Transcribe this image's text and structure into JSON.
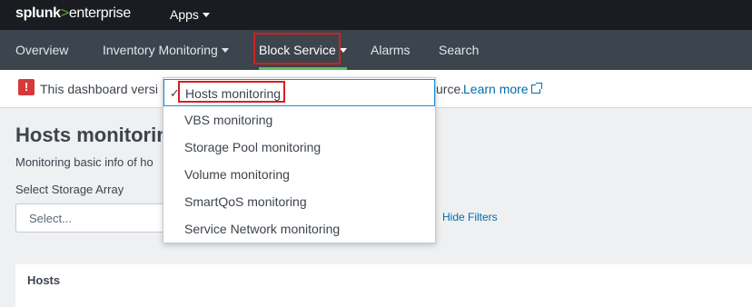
{
  "topbar": {
    "logo_main": "splunk",
    "logo_sep": ">",
    "logo_sub": "enterprise",
    "apps_label": "Apps"
  },
  "nav": {
    "items": [
      {
        "label": "Overview"
      },
      {
        "label": "Inventory Monitoring",
        "has_caret": true
      },
      {
        "label": "Block Service",
        "has_caret": true,
        "active": true
      },
      {
        "label": "Alarms"
      },
      {
        "label": "Search"
      }
    ]
  },
  "banner": {
    "text_start": "This dashboard versi",
    "text_end": "urce.",
    "learn_more": "Learn more"
  },
  "dashboard": {
    "title": "Hosts monitorin",
    "description": "Monitoring basic info of ho",
    "input_label": "Select Storage Array",
    "select_placeholder": "Select...",
    "hide_filters": "Hide Filters",
    "panel_title": "Hosts"
  },
  "dropdown": {
    "items": [
      {
        "label": "Hosts monitoring",
        "selected": true
      },
      {
        "label": "VBS monitoring"
      },
      {
        "label": "Storage Pool monitoring"
      },
      {
        "label": "Volume monitoring"
      },
      {
        "label": "SmartQoS monitoring"
      },
      {
        "label": "Service Network monitoring"
      }
    ],
    "check_glyph": "✓"
  },
  "colors": {
    "topbar_bg": "#1a1c21",
    "navbar_bg": "#3c444d",
    "active_underline": "#5cc05c",
    "link": "#006eaa",
    "warning": "#d6393a",
    "highlight_box": "#d42020"
  }
}
